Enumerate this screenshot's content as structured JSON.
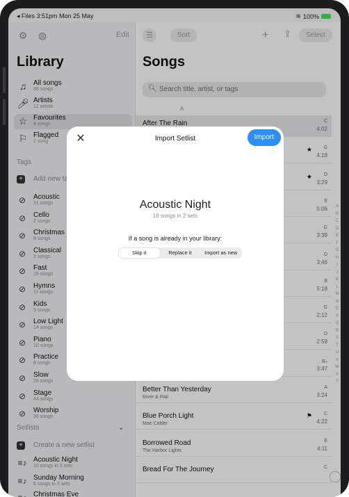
{
  "status": {
    "time": "◂ Files  3:51pm  Mon 25 May",
    "battery": "100%"
  },
  "sidebar": {
    "edit_label": "Edit",
    "title": "Library",
    "library_items": [
      {
        "label": "All songs",
        "sub": "88 songs",
        "icon": "music-notes-icon"
      },
      {
        "label": "Artists",
        "sub": "12 artists",
        "icon": "microphone-icon"
      },
      {
        "label": "Favourites",
        "sub": "4 songs",
        "icon": "star-icon"
      },
      {
        "label": "Flagged",
        "sub": "1 song",
        "icon": "flag-icon"
      }
    ],
    "tags_header": "Tags",
    "add_tag_label": "Add new tag",
    "tags": [
      {
        "label": "Acoustic",
        "sub": "31 songs"
      },
      {
        "label": "Cello",
        "sub": "2 songs"
      },
      {
        "label": "Christmas",
        "sub": "8 songs"
      },
      {
        "label": "Classical",
        "sub": "2 songs"
      },
      {
        "label": "Fast",
        "sub": "15 songs"
      },
      {
        "label": "Hymns",
        "sub": "11 songs"
      },
      {
        "label": "Kids",
        "sub": "9 songs"
      },
      {
        "label": "Low Light",
        "sub": "14 songs"
      },
      {
        "label": "Piano",
        "sub": "10 songs"
      },
      {
        "label": "Practice",
        "sub": "8 songs"
      },
      {
        "label": "Slow",
        "sub": "26 songs"
      },
      {
        "label": "Stage",
        "sub": "44 songs"
      },
      {
        "label": "Worship",
        "sub": "36 songs"
      }
    ],
    "setlists_header": "Setlists",
    "create_setlist_label": "Create a new setlist",
    "setlists": [
      {
        "label": "Acoustic Night",
        "sub": "10 songs in 2 sets"
      },
      {
        "label": "Sunday Morning",
        "sub": "6 songs in 3 sets"
      },
      {
        "label": "Christmas Eve",
        "sub": ""
      }
    ]
  },
  "main": {
    "sort_label": "Sort",
    "select_label": "Select",
    "title": "Songs",
    "search_placeholder": "Search title, artist, or tags",
    "section_letter": "A",
    "songs": [
      {
        "title": "After The Rain",
        "artist": "Jonah Bell",
        "key": "C",
        "duration": "4:02"
      },
      {
        "title": "",
        "artist": "",
        "key": "G",
        "duration": "4:18"
      },
      {
        "title": "",
        "artist": "",
        "key": "D",
        "duration": "3:29"
      },
      {
        "title": "",
        "artist": "",
        "key": "E",
        "duration": "5:06"
      },
      {
        "title": "",
        "artist": "",
        "key": "G",
        "duration": "3:39"
      },
      {
        "title": "",
        "artist": "",
        "key": "D",
        "duration": "3:46"
      },
      {
        "title": "",
        "artist": "",
        "key": "B",
        "duration": "5:18"
      },
      {
        "title": "",
        "artist": "",
        "key": "G",
        "duration": "2:12"
      },
      {
        "title": "",
        "artist": "",
        "key": "D",
        "duration": "2:59"
      },
      {
        "title": "",
        "artist": "Sunday House Choir",
        "key": "B♭",
        "duration": "3:47"
      },
      {
        "title": "Better Than Yesterday",
        "artist": "River & Rail",
        "key": "A",
        "duration": "3:24"
      },
      {
        "title": "Blue Porch Light",
        "artist": "Mae Calder",
        "key": "C",
        "duration": "4:22"
      },
      {
        "title": "Borrowed Road",
        "artist": "The Harbor Lights",
        "key": "E",
        "duration": "4:11"
      },
      {
        "title": "Bread For The Journey",
        "artist": "",
        "key": "C",
        "duration": ""
      }
    ],
    "index_letters": [
      "A",
      "B",
      "C",
      "D",
      "E",
      "F",
      "G",
      "H",
      "I",
      "J",
      "K",
      "L",
      "M",
      "N",
      "O",
      "P",
      "Q",
      "R",
      "S",
      "T",
      "U",
      "V",
      "W",
      "X",
      "Y"
    ]
  },
  "modal": {
    "title": "Import Setlist",
    "import_label": "Import",
    "setlist_title": "Acoustic Night",
    "setlist_sub": "10 songs in 2 sets",
    "question": "If a song is already in your library:",
    "options": [
      "Skip it",
      "Replace it",
      "Import as new"
    ],
    "selected_option": "Skip it"
  },
  "colors": {
    "accent": "#2f8ef4",
    "battery": "#4cd964"
  }
}
